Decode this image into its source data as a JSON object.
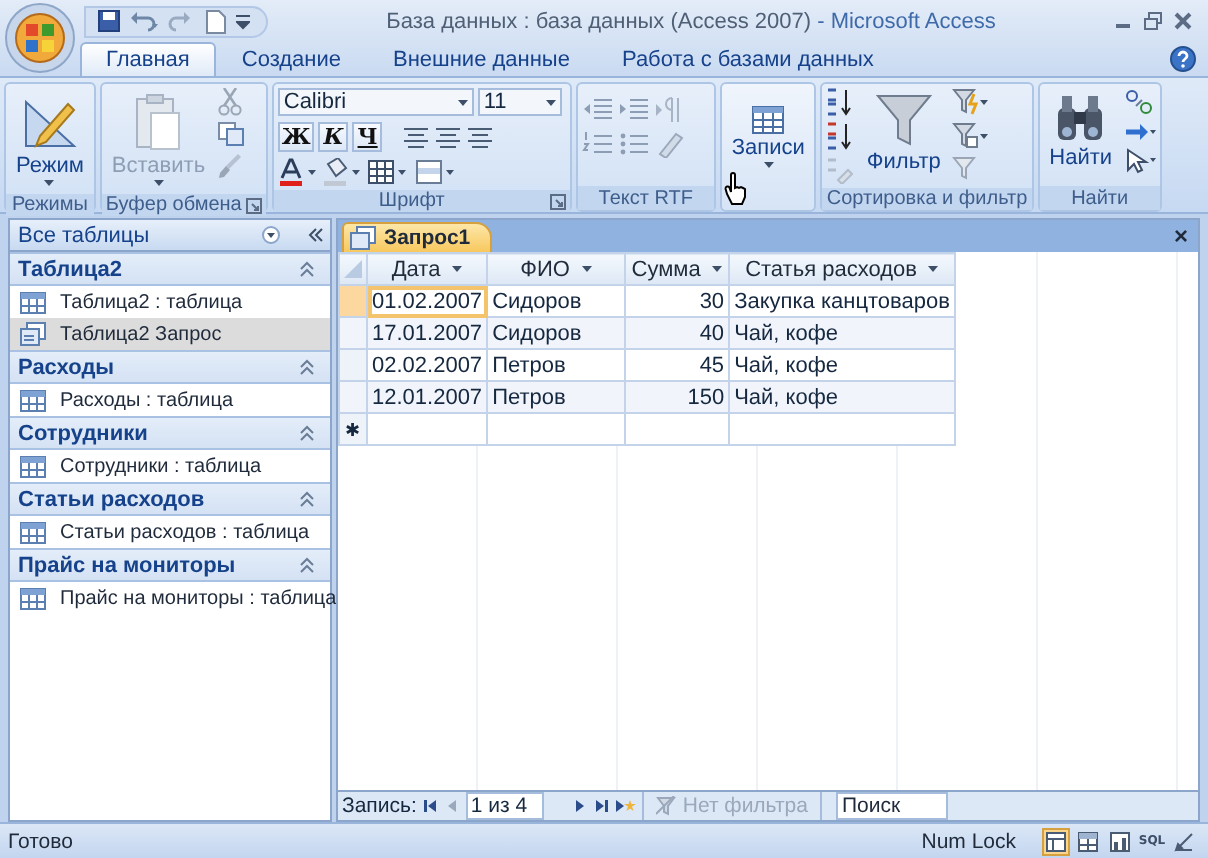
{
  "window": {
    "title_document": "База данных : база данных (Access 2007)",
    "title_app": " - Microsoft Access"
  },
  "ribbon": {
    "tabs": [
      {
        "label": "Главная",
        "selected": true
      },
      {
        "label": "Создание",
        "selected": false
      },
      {
        "label": "Внешние данные",
        "selected": false
      },
      {
        "label": "Работа с базами данных",
        "selected": false
      }
    ],
    "groups": [
      {
        "kind": "views",
        "label": "Режимы",
        "button": "Режим"
      },
      {
        "kind": "clipboard",
        "label": "Буфер обмена",
        "button": "Вставить",
        "disabled": true
      },
      {
        "kind": "font",
        "label": "Шрифт",
        "font": "Calibri",
        "size": "11",
        "bold": "Ж",
        "italic": "К",
        "underline": "Ч"
      },
      {
        "kind": "rtf",
        "label": "Текст RTF"
      },
      {
        "kind": "records",
        "button": "Записи"
      },
      {
        "kind": "sort",
        "label": "Сортировка и фильтр",
        "button": "Фильтр"
      },
      {
        "kind": "find",
        "label": "Найти",
        "button": "Найти"
      }
    ]
  },
  "navigation": {
    "header": "Все таблицы",
    "groups": [
      {
        "title": "Таблица2",
        "expanded": true,
        "items": [
          {
            "label": "Таблица2 : таблица",
            "kind": "table",
            "selected": false
          },
          {
            "label": "Таблица2 Запрос",
            "kind": "query",
            "selected": true
          }
        ]
      },
      {
        "title": "Расходы",
        "expanded": true,
        "items": [
          {
            "label": "Расходы : таблица",
            "kind": "table",
            "selected": false
          }
        ]
      },
      {
        "title": "Сотрудники",
        "expanded": true,
        "items": [
          {
            "label": "Сотрудники : таблица",
            "kind": "table",
            "selected": false
          }
        ]
      },
      {
        "title": "Статьи расходов",
        "expanded": true,
        "items": [
          {
            "label": "Статьи расходов : таблица",
            "kind": "table",
            "selected": false
          }
        ]
      },
      {
        "title": "Прайс на мониторы",
        "expanded": true,
        "items": [
          {
            "label": "Прайс на мониторы : таблица",
            "kind": "table",
            "selected": false
          }
        ]
      }
    ]
  },
  "document": {
    "tab": "Запрос1",
    "close": "×",
    "columns": [
      {
        "label": "Дата",
        "kind": "text"
      },
      {
        "label": "ФИО",
        "kind": "text"
      },
      {
        "label": "Сумма",
        "kind": "number"
      },
      {
        "label": "Статья расходов",
        "kind": "text"
      }
    ],
    "rows": [
      {
        "cells": [
          "01.02.2007",
          "Сидоров",
          "30",
          "Закупка канцтоваров"
        ],
        "selected": true
      },
      {
        "cells": [
          "17.01.2007",
          "Сидоров",
          "40",
          "Чай, кофе"
        ],
        "selected": false
      },
      {
        "cells": [
          "02.02.2007",
          "Петров",
          "45",
          "Чай, кофе"
        ],
        "selected": false
      },
      {
        "cells": [
          "12.01.2007",
          "Петров",
          "150",
          "Чай, кофе"
        ],
        "selected": false
      }
    ],
    "new_row_marker": "✱",
    "record_nav": {
      "label": "Запись:",
      "position": "1 из 4",
      "filter": "Нет фильтра",
      "search_placeholder": "Поиск"
    }
  },
  "status_bar": {
    "text": "Готово",
    "num_lock": "Num Lock",
    "views": [
      {
        "kind": "datasheet",
        "selected": true
      },
      {
        "kind": "pivot-table",
        "selected": false
      },
      {
        "kind": "pivot-chart",
        "selected": false
      },
      {
        "kind": "sql",
        "text": "SQL",
        "selected": false
      },
      {
        "kind": "design",
        "selected": false
      }
    ]
  }
}
